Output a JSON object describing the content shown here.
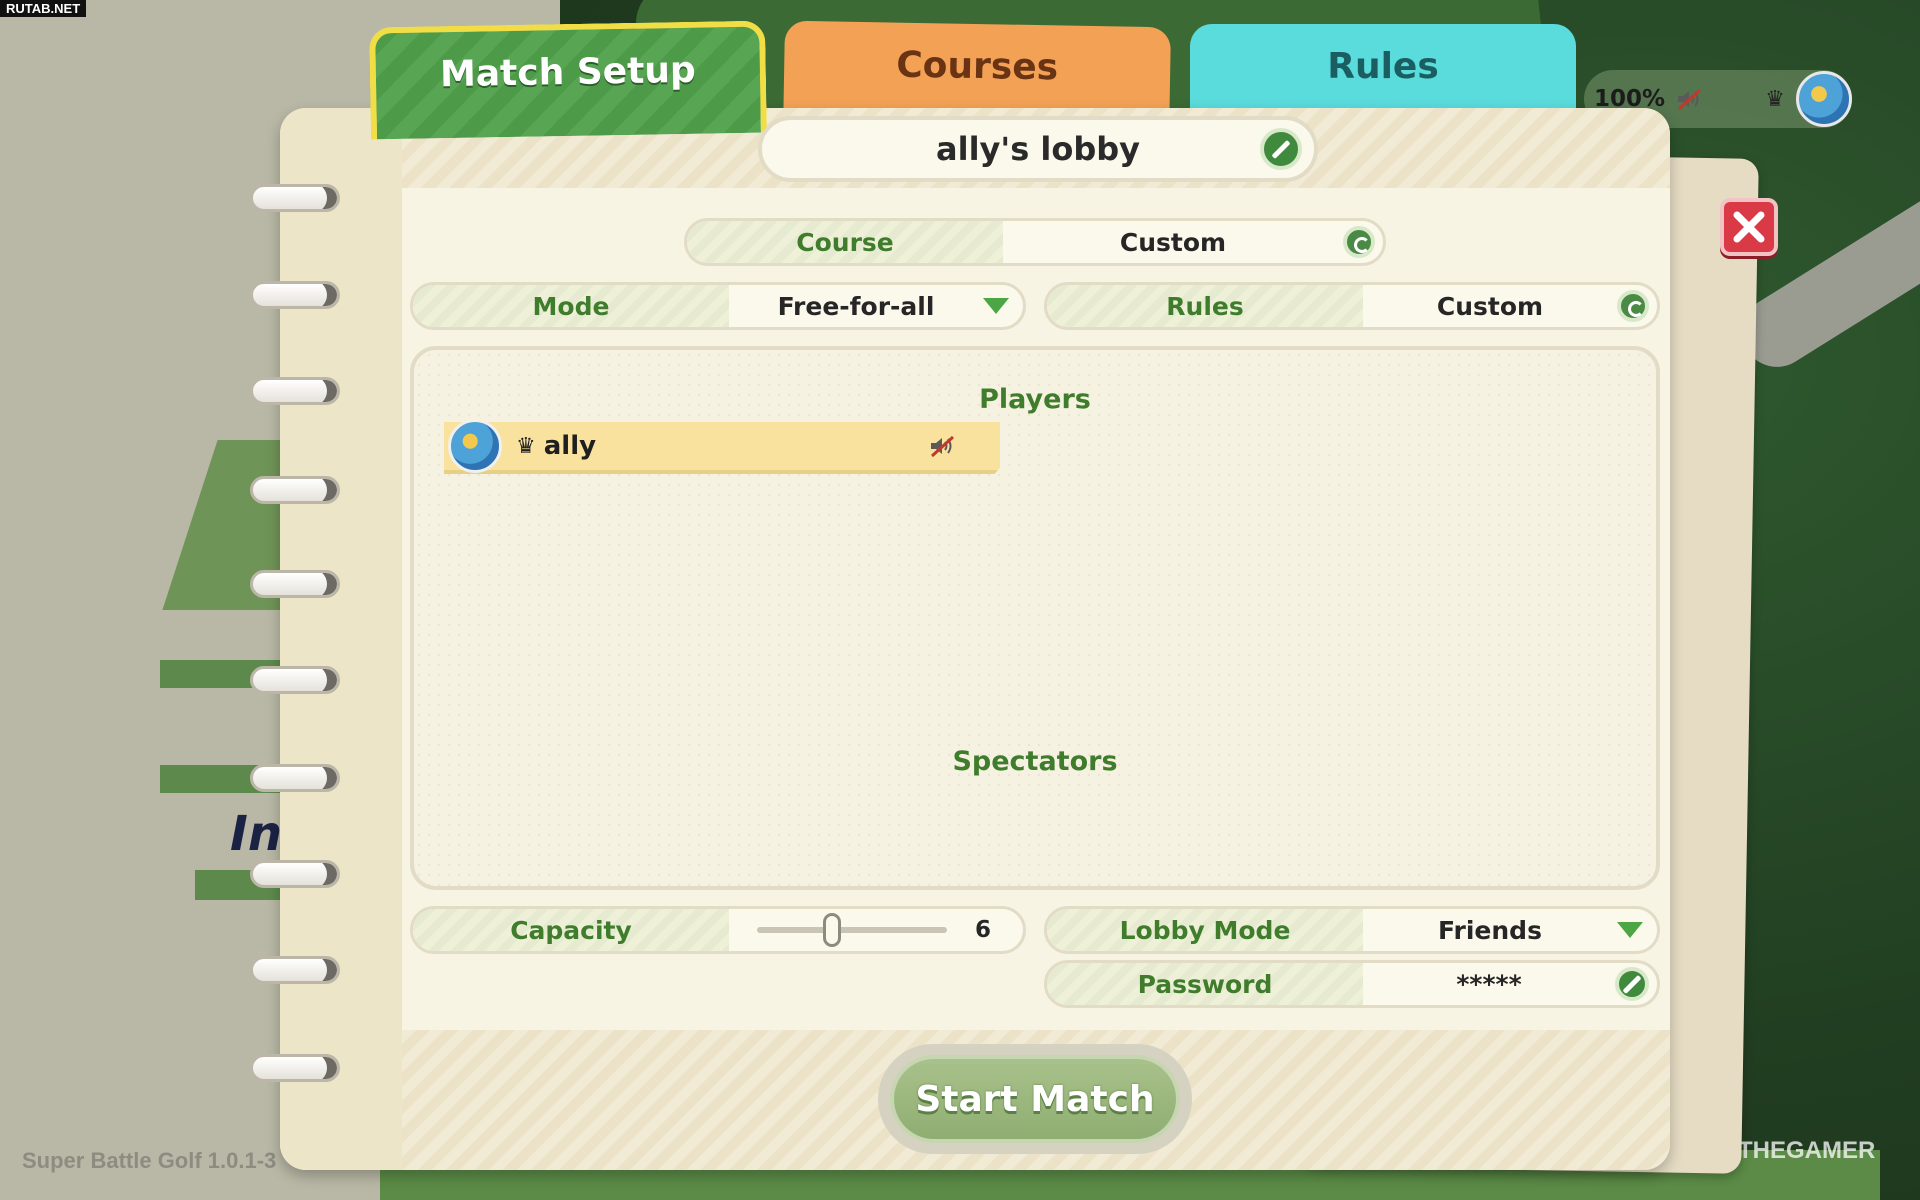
{
  "watermark_site": "RUTAB.NET",
  "watermark_brand": "THEGAMER",
  "version_text": "Super Battle Golf 1.0.1-3",
  "background_text": "In",
  "tabs": [
    {
      "label": "Match Setup",
      "active": true
    },
    {
      "label": "Courses",
      "active": false
    },
    {
      "label": "Rules",
      "active": false
    }
  ],
  "status": {
    "volume": "100%",
    "icons": [
      "muted-speaker-icon",
      "crown-icon",
      "avatar"
    ]
  },
  "lobby": {
    "name": "ally's lobby"
  },
  "settings": {
    "course": {
      "label": "Course",
      "value": "Custom"
    },
    "mode": {
      "label": "Mode",
      "value": "Free-for-all"
    },
    "rules": {
      "label": "Rules",
      "value": "Custom"
    },
    "capacity": {
      "label": "Capacity",
      "value": "6",
      "level": 0.4
    },
    "lobby_mode": {
      "label": "Lobby Mode",
      "value": "Friends"
    },
    "password": {
      "label": "Password",
      "value": "*****"
    }
  },
  "players_title": "Players",
  "spectators_title": "Spectators",
  "players": [
    {
      "name": "ally",
      "host": true,
      "muted": true
    }
  ],
  "start_button": "Start Match",
  "colors": {
    "accent_green": "#3f7c2c",
    "active_tab_border": "#f1de47",
    "courses_tab": "#f3a255",
    "rules_tab": "#5adbdc",
    "close_red": "#d93a46"
  }
}
